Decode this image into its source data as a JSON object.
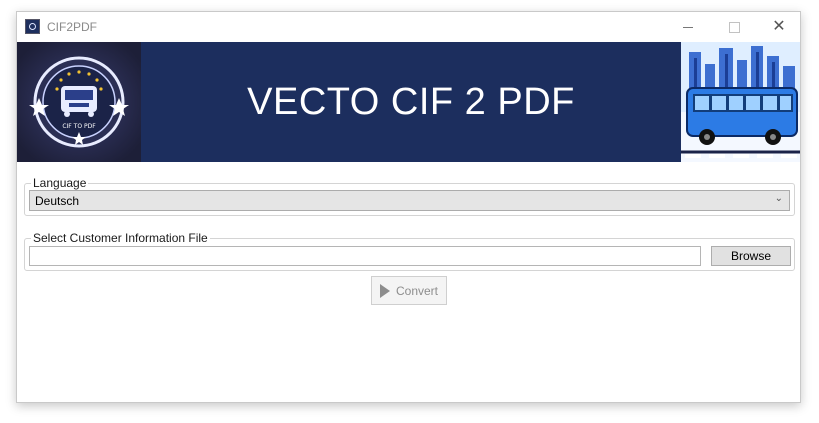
{
  "window": {
    "title": "CIF2PDF"
  },
  "controls": {
    "minimize": "minimize",
    "maximize": "maximize",
    "close": "✕"
  },
  "banner": {
    "title": "VECTO CIF 2 PDF",
    "logo_text": "CIF TO PDF",
    "colors": {
      "banner_bg": "#1c2e5e"
    }
  },
  "language": {
    "label": "Language",
    "selected": "Deutsch"
  },
  "file": {
    "label": "Select Customer Information File",
    "value": "",
    "browse_label": "Browse"
  },
  "convert": {
    "label": "Convert",
    "enabled": false
  },
  "icons": [
    "app-icon",
    "chevron-down-icon",
    "play-icon",
    "close-icon",
    "minimize-icon",
    "maximize-icon"
  ]
}
